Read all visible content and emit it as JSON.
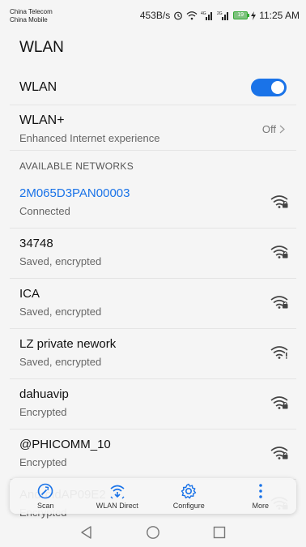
{
  "status_bar": {
    "carrier1": "China Telecom",
    "carrier2": "China Mobile",
    "speed": "453B/s",
    "battery": "19",
    "time": "11:25 AM"
  },
  "title": "WLAN",
  "wlan": {
    "label": "WLAN",
    "enabled": true
  },
  "wlan_plus": {
    "label": "WLAN+",
    "sub": "Enhanced Internet experience",
    "value": "Off"
  },
  "section_header": "AVAILABLE NETWORKS",
  "networks": [
    {
      "name": "2M065D3PAN00003",
      "status": "Connected",
      "locked": true,
      "connected": true
    },
    {
      "name": "34748",
      "status": "Saved, encrypted",
      "locked": true
    },
    {
      "name": "ICA",
      "status": "Saved, encrypted",
      "locked": true
    },
    {
      "name": "LZ private nework",
      "status": "Saved, encrypted",
      "locked": false,
      "alert": true
    },
    {
      "name": "dahuavip",
      "status": "Encrypted",
      "locked": true
    },
    {
      "name": "@PHICOMM_10",
      "status": "Encrypted",
      "locked": true
    },
    {
      "name": "AndroidAP09E2",
      "status": "Encrypted",
      "locked": true
    }
  ],
  "toolbar": {
    "scan": "Scan",
    "wlan_direct": "WLAN Direct",
    "configure": "Configure",
    "more": "More"
  },
  "colors": {
    "accent": "#1a73e8",
    "background": "#f5f5f5"
  }
}
